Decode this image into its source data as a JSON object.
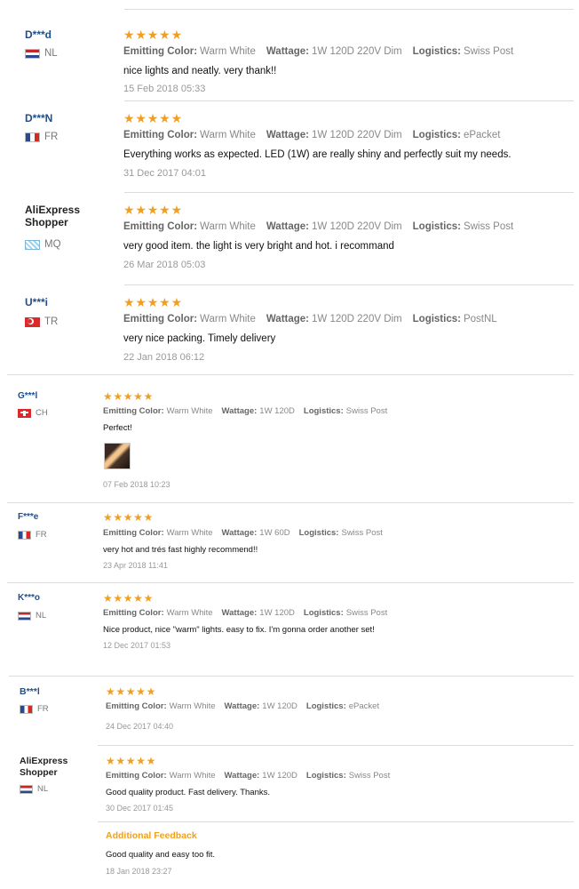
{
  "labels": {
    "emitting_color": "Emitting Color:",
    "wattage": "Wattage:",
    "logistics": "Logistics:",
    "additional_feedback": "Additional Feedback"
  },
  "colors": {
    "star": "#f0a020",
    "username": "#1f4e8c",
    "additional_feedback": "#f0a020"
  },
  "reviews": [
    {
      "user": "D***d",
      "country": "NL",
      "flag": "nl-flag-icon",
      "stars": 5,
      "color": "Warm White",
      "wattage": "1W 120D 220V Dim",
      "logistics": "Swiss Post",
      "text": "nice lights and neatly. very thank!!",
      "date": "15 Feb 2018 05:33"
    },
    {
      "user": "D***N",
      "country": "FR",
      "flag": "fr-flag-icon",
      "stars": 5,
      "color": "Warm White",
      "wattage": "1W 120D 220V Dim",
      "logistics": "ePacket",
      "text": "Everything works as expected. LED (1W) are really shiny and perfectly suit my needs.",
      "date": "31 Dec 2017 04:01"
    },
    {
      "user": "AliExpress Shopper",
      "country": "MQ",
      "flag": "mq-flag-icon",
      "stars": 5,
      "color": "Warm White",
      "wattage": "1W 120D 220V Dim",
      "logistics": "Swiss Post",
      "text": "very good item. the light is very bright and hot. i recommand",
      "date": "26 Mar 2018 05:03"
    },
    {
      "user": "U***i",
      "country": "TR",
      "flag": "tr-flag-icon",
      "stars": 5,
      "color": "Warm White",
      "wattage": "1W 120D 220V Dim",
      "logistics": "PostNL",
      "text": "very nice packing. Timely delivery",
      "date": "22 Jan 2018 06:12"
    },
    {
      "user": "G***l",
      "country": "CH",
      "flag": "ch-flag-icon",
      "stars": 5,
      "color": "Warm White",
      "wattage": "1W 120D",
      "logistics": "Swiss Post",
      "text": "Perfect!",
      "date": "07 Feb 2018 10:23"
    },
    {
      "user": "F***e",
      "country": "FR",
      "flag": "fr-flag-icon",
      "stars": 5,
      "color": "Warm White",
      "wattage": "1W 60D",
      "logistics": "Swiss Post",
      "text": "very hot and trés fast highly recommend!!",
      "date": "23 Apr 2018 11:41"
    },
    {
      "user": "K***o",
      "country": "NL",
      "flag": "nl-flag-icon",
      "stars": 5,
      "color": "Warm White",
      "wattage": "1W 120D",
      "logistics": "Swiss Post",
      "text": "Nice product, nice \"warm\" lights. easy to fix. I'm gonna order another set!",
      "date": "12 Dec 2017 01:53"
    },
    {
      "user": "B***l",
      "country": "FR",
      "flag": "fr-flag-icon",
      "stars": 5,
      "color": "Warm White",
      "wattage": "1W 120D",
      "logistics": "ePacket",
      "text": "",
      "date": "24 Dec 2017 04:40"
    },
    {
      "user": "AliExpress Shopper",
      "country": "NL",
      "flag": "nl-flag-icon",
      "stars": 5,
      "color": "Warm White",
      "wattage": "1W 120D",
      "logistics": "Swiss Post",
      "text": "Good quality product. Fast delivery. Thanks.",
      "date": "30 Dec 2017 01:45",
      "additional_text": "Good quality and easy too fit.",
      "additional_date": "18 Jan 2018 23:27"
    }
  ]
}
